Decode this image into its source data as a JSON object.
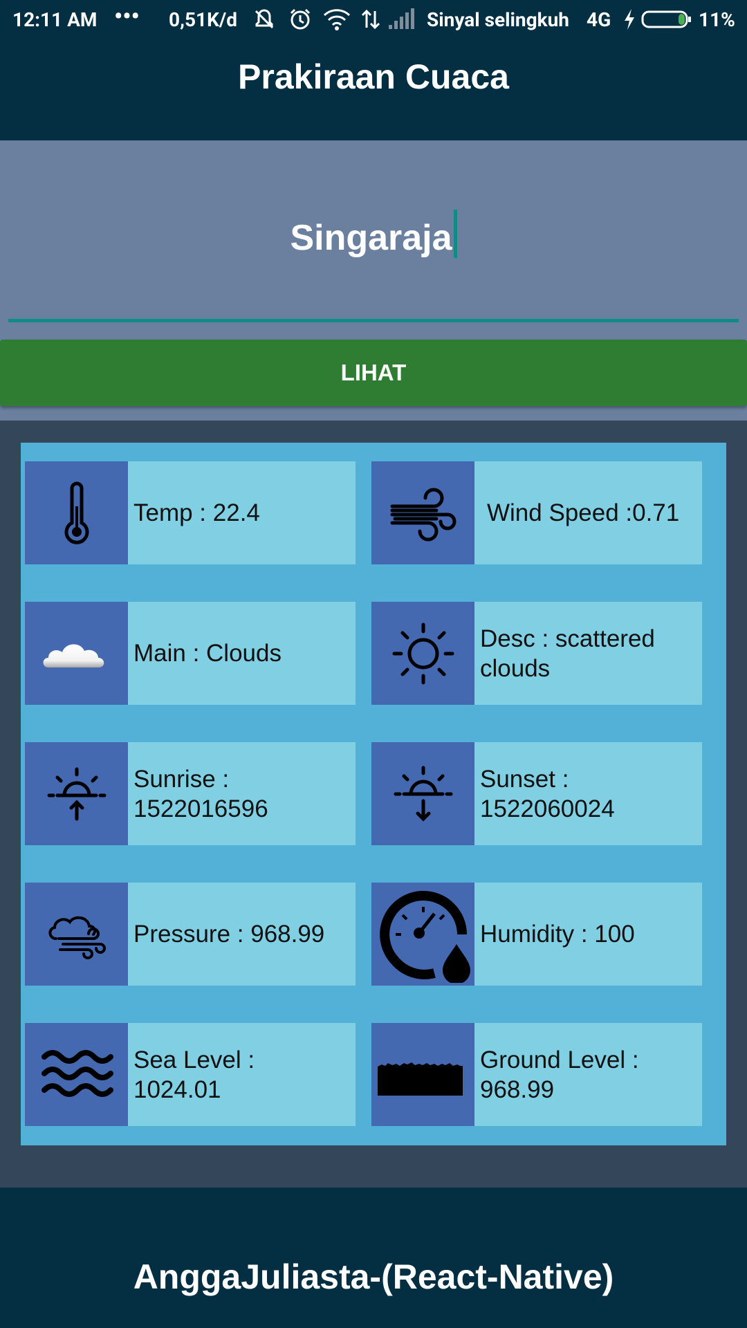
{
  "status_bar": {
    "time": "12:11 AM",
    "dots": "•••",
    "speed": "0,51K/d",
    "carrier": "Sinyal selingkuh",
    "network": "4G",
    "battery": "11%"
  },
  "header": {
    "title": "Prakiraan Cuaca"
  },
  "search": {
    "city_value": "Singaraja",
    "button_label": "LIHAT"
  },
  "weather": {
    "temp": "Temp : 22.4",
    "wind": "Wind Speed :0.71",
    "main": "Main : Clouds",
    "desc_line1": "Desc : scattered",
    "desc_line2": "clouds",
    "sunrise_line1": "Sunrise :",
    "sunrise_line2": "1522016596",
    "sunset_line1": "Sunset :",
    "sunset_line2": "1522060024",
    "pressure": "Pressure : 968.99",
    "humidity": "Humidity : 100",
    "sealevel_line1": "Sea Level :",
    "sealevel_line2": "1024.01",
    "groundlevel_line1": "Ground Level :",
    "groundlevel_line2": "968.99"
  },
  "footer": {
    "text": "AnggaJuliasta-(React-Native)"
  },
  "colors": {
    "header_bg": "#042f42",
    "search_bg": "#6b809f",
    "accent_teal": "#0f8c86",
    "button_green": "#2e7d32",
    "panel_bg": "#53b1d8",
    "card_bg": "#80cfe2",
    "icon_box_bg": "#4469b1"
  }
}
